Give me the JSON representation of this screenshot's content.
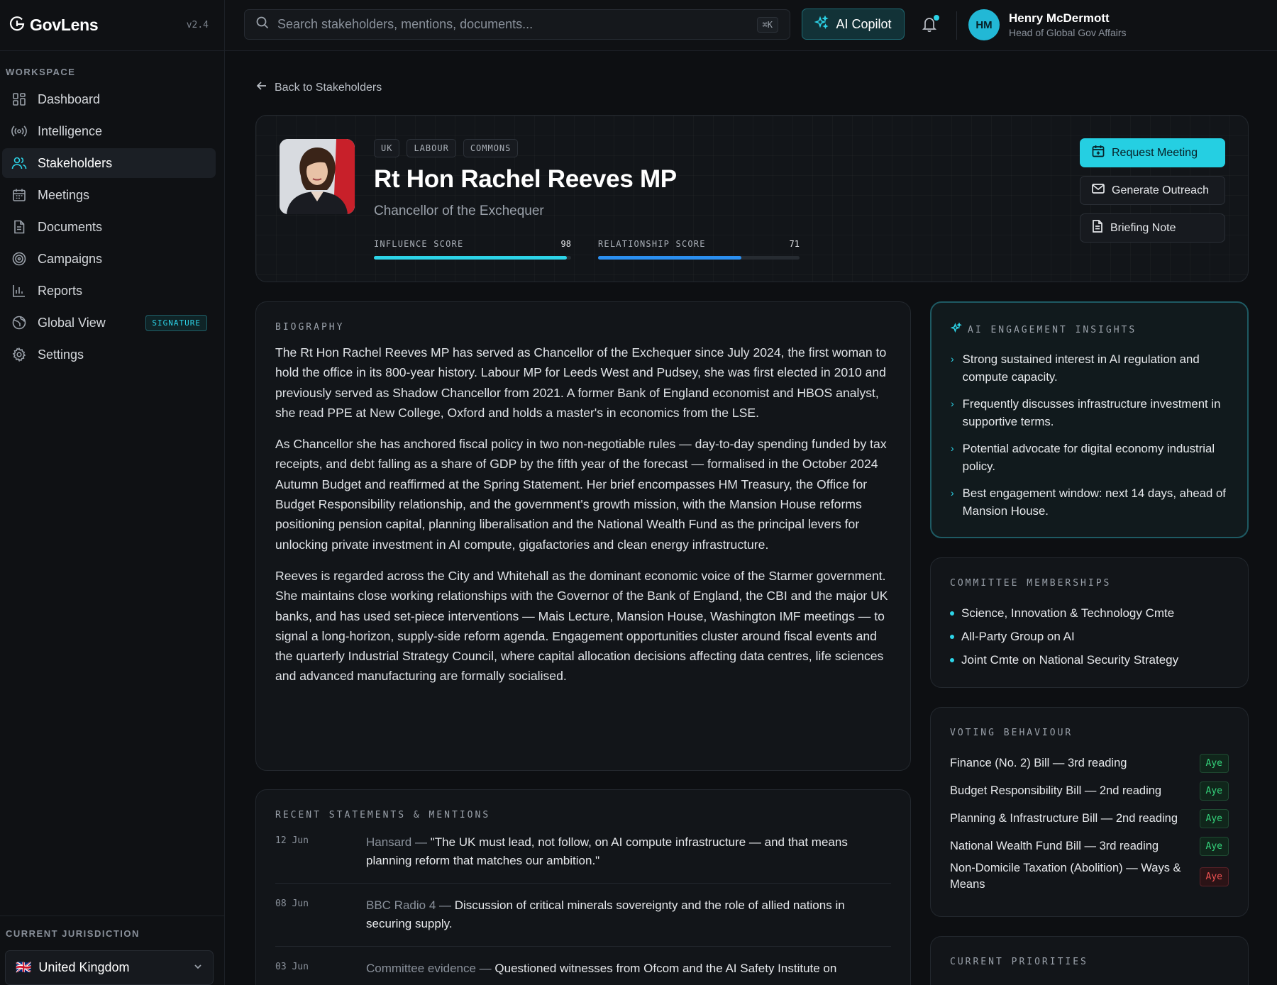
{
  "brand": {
    "name": "GovLens",
    "version": "v2.4"
  },
  "sidebar": {
    "section_label": "WORKSPACE",
    "items": [
      {
        "label": "Dashboard",
        "icon": "grid-icon"
      },
      {
        "label": "Intelligence",
        "icon": "signal-icon"
      },
      {
        "label": "Stakeholders",
        "icon": "users-icon",
        "active": true
      },
      {
        "label": "Meetings",
        "icon": "calendar-icon"
      },
      {
        "label": "Documents",
        "icon": "document-icon"
      },
      {
        "label": "Campaigns",
        "icon": "target-icon"
      },
      {
        "label": "Reports",
        "icon": "bar-chart-icon"
      },
      {
        "label": "Global View",
        "icon": "globe-icon",
        "badge": "SIGNATURE"
      },
      {
        "label": "Settings",
        "icon": "gear-icon"
      }
    ],
    "jurisdiction": {
      "label": "CURRENT JURISDICTION",
      "flag": "🇬🇧",
      "value": "United Kingdom"
    }
  },
  "topbar": {
    "search_placeholder": "Search stakeholders, mentions, documents...",
    "search_shortcut": "⌘K",
    "copilot_label": "AI Copilot",
    "user": {
      "initials": "HM",
      "name": "Henry McDermott",
      "role": "Head of Global Gov Affairs"
    }
  },
  "nav": {
    "back_label": "Back to Stakeholders"
  },
  "profile": {
    "tags": [
      "UK",
      "LABOUR",
      "COMMONS"
    ],
    "name": "Rt Hon Rachel Reeves MP",
    "role": "Chancellor of the Exchequer",
    "influence": {
      "label": "INFLUENCE SCORE",
      "value": 98,
      "color": "#2dd4e8"
    },
    "relationship": {
      "label": "RELATIONSHIP SCORE",
      "value": 71,
      "color": "#2b8ff0"
    },
    "actions": {
      "request": "Request Meeting",
      "outreach": "Generate Outreach",
      "briefing": "Briefing Note"
    }
  },
  "biography": {
    "title": "BIOGRAPHY",
    "paragraphs": [
      "The Rt Hon Rachel Reeves MP has served as Chancellor of the Exchequer since July 2024, the first woman to hold the office in its 800-year history. Labour MP for Leeds West and Pudsey, she was first elected in 2010 and previously served as Shadow Chancellor from 2021. A former Bank of England economist and HBOS analyst, she read PPE at New College, Oxford and holds a master's in economics from the LSE.",
      "As Chancellor she has anchored fiscal policy in two non-negotiable rules — day-to-day spending funded by tax receipts, and debt falling as a share of GDP by the fifth year of the forecast — formalised in the October 2024 Autumn Budget and reaffirmed at the Spring Statement. Her brief encompasses HM Treasury, the Office for Budget Responsibility relationship, and the government's growth mission, with the Mansion House reforms positioning pension capital, planning liberalisation and the National Wealth Fund as the principal levers for unlocking private investment in AI compute, gigafactories and clean energy infrastructure.",
      "Reeves is regarded across the City and Whitehall as the dominant economic voice of the Starmer government. She maintains close working relationships with the Governor of the Bank of England, the CBI and the major UK banks, and has used set-piece interventions — Mais Lecture, Mansion House, Washington IMF meetings — to signal a long-horizon, supply-side reform agenda. Engagement opportunities cluster around fiscal events and the quarterly Industrial Strategy Council, where capital allocation decisions affecting data centres, life sciences and advanced manufacturing are formally socialised."
    ]
  },
  "mentions": {
    "title": "RECENT STATEMENTS & MENTIONS",
    "items": [
      {
        "date": "12 Jun",
        "source": "Hansard —",
        "text": "\"The UK must lead, not follow, on AI compute infrastructure — and that means planning reform that matches our ambition.\""
      },
      {
        "date": "08 Jun",
        "source": "BBC Radio 4 —",
        "text": "Discussion of critical minerals sovereignty and the role of allied nations in securing supply."
      },
      {
        "date": "03 Jun",
        "source": "Committee evidence —",
        "text": "Questioned witnesses from Ofcom and the AI Safety Institute on"
      }
    ]
  },
  "insights": {
    "title": "AI ENGAGEMENT INSIGHTS",
    "items": [
      "Strong sustained interest in AI regulation and compute capacity.",
      "Frequently discusses infrastructure investment in supportive terms.",
      "Potential advocate for digital economy industrial policy.",
      "Best engagement window: next 14 days, ahead of Mansion House."
    ]
  },
  "committees": {
    "title": "COMMITTEE MEMBERSHIPS",
    "items": [
      "Science, Innovation & Technology Cmte",
      "All-Party Group on AI",
      "Joint Cmte on National Security Strategy"
    ]
  },
  "voting": {
    "title": "VOTING BEHAVIOUR",
    "items": [
      {
        "bill": "Finance (No. 2) Bill — 3rd reading",
        "vote": "Aye"
      },
      {
        "bill": "Budget Responsibility Bill — 2nd reading",
        "vote": "Aye"
      },
      {
        "bill": "Planning & Infrastructure Bill — 2nd reading",
        "vote": "Aye"
      },
      {
        "bill": "National Wealth Fund Bill — 3rd reading",
        "vote": "Aye"
      },
      {
        "bill": "Non-Domicile Taxation (Abolition) — Ways & Means",
        "vote": "Aye"
      }
    ]
  },
  "priorities": {
    "title": "CURRENT PRIORITIES"
  },
  "colors": {
    "accent": "#2dd4e8",
    "aye": "#34d37b",
    "no": "#f05252"
  }
}
